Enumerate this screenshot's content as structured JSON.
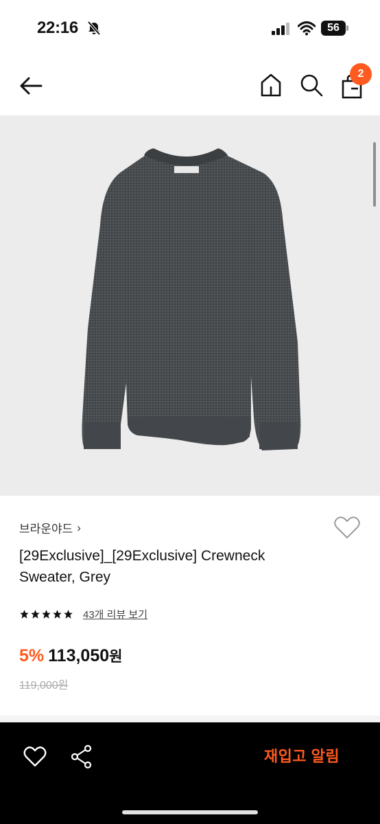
{
  "status_bar": {
    "time": "22:16",
    "battery_level": "56",
    "icons": [
      "bell-slash-icon",
      "signal-icon",
      "wifi-icon",
      "battery-icon"
    ]
  },
  "header": {
    "icons": [
      "back-arrow-icon",
      "home-icon",
      "search-icon",
      "shopping-bag-icon"
    ],
    "cart_count": "2"
  },
  "product": {
    "image_icon": "sweater-image",
    "brand": "브라운야드",
    "title": "[29Exclusive]_[29Exclusive] Crewneck Sweater, Grey",
    "rating_stars": 5,
    "review_link": "43개 리뷰 보기",
    "discount": "5%",
    "sale_price": "113,050",
    "currency": "원",
    "original_price": "119,000원"
  },
  "bottom_bar": {
    "icons": [
      "heart-icon",
      "share-icon"
    ],
    "restock_label": "재입고 알림"
  },
  "colors": {
    "accent": "#ff5a1f",
    "bottom_bar_bg": "#000000",
    "image_bg": "#ececec"
  }
}
